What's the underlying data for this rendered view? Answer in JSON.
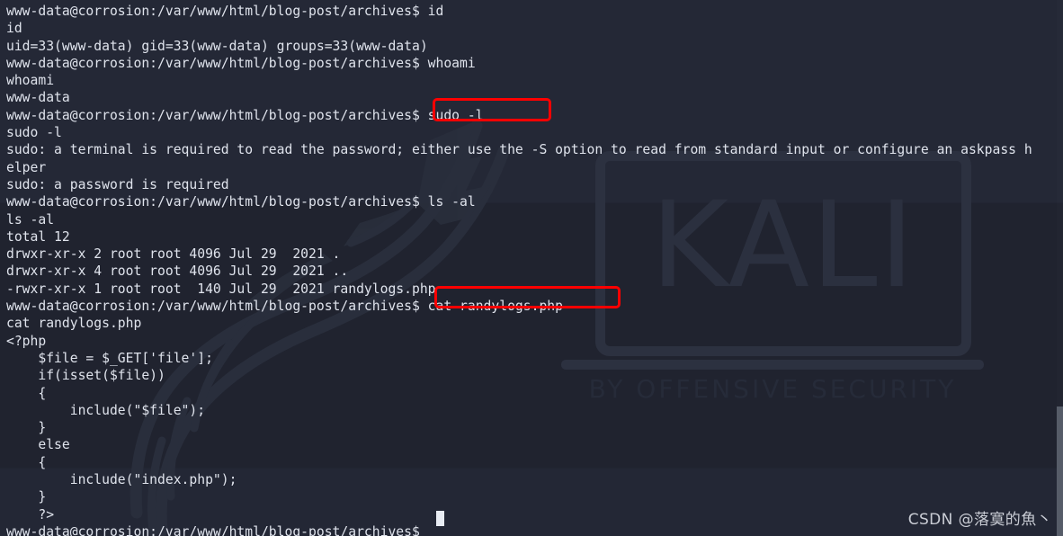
{
  "terminal": {
    "prompt": "www-data@corrosion:/var/www/html/blog-post/archives$ ",
    "lines": [
      "www-data@corrosion:/var/www/html/blog-post/archives$ id",
      "id",
      "uid=33(www-data) gid=33(www-data) groups=33(www-data)",
      "www-data@corrosion:/var/www/html/blog-post/archives$ whoami",
      "whoami",
      "www-data",
      "www-data@corrosion:/var/www/html/blog-post/archives$ sudo -l",
      "sudo -l",
      "sudo: a terminal is required to read the password; either use the -S option to read from standard input or configure an askpass h",
      "elper",
      "sudo: a password is required",
      "www-data@corrosion:/var/www/html/blog-post/archives$ ls -al",
      "ls -al",
      "total 12",
      "drwxr-xr-x 2 root root 4096 Jul 29  2021 .",
      "drwxr-xr-x 4 root root 4096 Jul 29  2021 ..",
      "-rwxr-xr-x 1 root root  140 Jul 29  2021 randylogs.php",
      "www-data@corrosion:/var/www/html/blog-post/archives$ cat randylogs.php",
      "cat randylogs.php",
      "<?php",
      "    $file = $_GET['file'];",
      "    if(isset($file))",
      "    {",
      "        include(\"$file\");",
      "    }",
      "    else",
      "    {",
      "        include(\"index.php\");",
      "    }",
      "    ?>",
      "www-data@corrosion:/var/www/html/blog-post/archives$ "
    ],
    "cursor_char": "block-cursor"
  },
  "annotations": {
    "box_1_label": "sudo -l",
    "box_2_label": "cat randylogs.php",
    "color": "#fe0000"
  },
  "background_logo": {
    "word": "KALI",
    "subtitle": "BY OFFENSIVE SECURITY",
    "dragon": "kali-dragon-mark"
  },
  "watermark": {
    "text": "CSDN @落寞的魚丶"
  },
  "scrollbar": {
    "name": "vertical-scrollbar"
  },
  "colors": {
    "background": "#242836",
    "text": "#dfe3ec",
    "annotation": "#fe0000",
    "logo": "#2c3140",
    "scrollbar_thumb": "#565c68"
  }
}
